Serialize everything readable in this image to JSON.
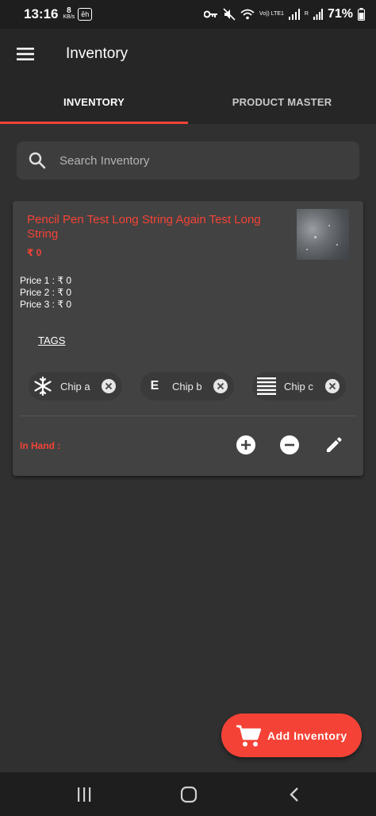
{
  "status_bar": {
    "time": "13:16",
    "net_speed_value": "8",
    "net_speed_unit": "KB/s",
    "app_badge": "ēh",
    "network": "Vo)) LTE1",
    "sim": "R",
    "battery": "71%"
  },
  "app_bar": {
    "title": "Inventory"
  },
  "tabs": [
    {
      "label": "INVENTORY",
      "active": true
    },
    {
      "label": "PRODUCT MASTER",
      "active": false
    }
  ],
  "search": {
    "placeholder": "Search Inventory"
  },
  "card": {
    "name": "Pencil Pen Test Long String Again Test Long String",
    "price": "₹ 0",
    "prices": [
      "Price 1 : ₹ 0",
      "Price 2 : ₹ 0",
      "Price 3 : ₹ 0"
    ],
    "tags_label": "TAGS",
    "chips": [
      {
        "label": "Chip a",
        "icon": "snowflake-icon"
      },
      {
        "label": "Chip b",
        "icon": "letter-e-icon",
        "avatar_text": "E"
      },
      {
        "label": "Chip c",
        "icon": "lines-icon"
      }
    ],
    "in_hand_label": "In Hand :"
  },
  "fab": {
    "label": "Add Inventory",
    "icon": "cart-icon"
  },
  "colors": {
    "accent": "#f44336",
    "background": "#303030",
    "card": "#424242"
  }
}
